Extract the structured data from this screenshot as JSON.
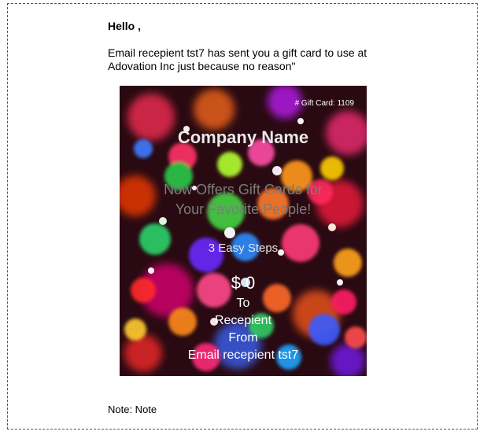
{
  "email": {
    "greeting": "Hello ,",
    "message_line1": "Email recepient tst7 has sent you a gift card to use at",
    "message_line2": "Adovation Inc just because no reason\"",
    "note": "Note: Note"
  },
  "gift_card": {
    "card_number_label": "# Gift Card: 1109",
    "company_name": "Company Name",
    "tagline_line1": "Now Offers Gift Cards for",
    "tagline_line2": "Your Favorite People!",
    "steps": "3 Easy Steps",
    "amount": "$ 0",
    "to_label": "To",
    "recipient": "Recepient",
    "from_label": "From",
    "sender": "Email recepient tst7"
  },
  "colors": {
    "card_bg": "#2a0a12",
    "company_text": "#e8e8e8",
    "tagline_text": "#7c7c7c",
    "frame_border": "#555555"
  }
}
